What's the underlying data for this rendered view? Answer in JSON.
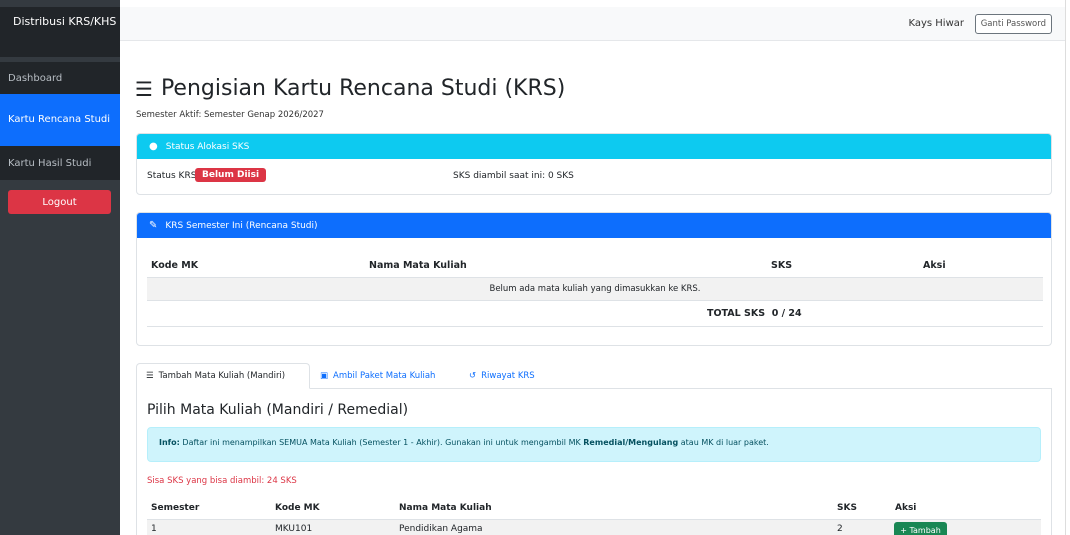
{
  "sidebar": {
    "brand": "Distribusi KRS/KHS",
    "items": [
      {
        "label": "Dashboard"
      },
      {
        "label": "Kartu Rencana Studi"
      },
      {
        "label": "Kartu Hasil Studi"
      }
    ],
    "logout_label": "Logout"
  },
  "topbar": {
    "user_name": "Kays Hiwar",
    "change_password_label": "Ganti Password"
  },
  "page": {
    "title": "Pengisian Kartu Rencana Studi (KRS)",
    "subtitle": "Semester Aktif: Semester Genap 2026/2027"
  },
  "status_card": {
    "header": "Status Alokasi SKS",
    "status_label": "Status KRS:",
    "status_badge": "Belum Diisi",
    "sks_taken": "SKS diambil saat ini: 0 SKS"
  },
  "krs_card": {
    "header": "KRS Semester Ini (Rencana Studi)",
    "columns": [
      "Kode MK",
      "Nama Mata Kuliah",
      "SKS",
      "Aksi"
    ],
    "empty_message": "Belum ada mata kuliah yang dimasukkan ke KRS.",
    "total_label": "TOTAL SKS",
    "total_value": "0 / 24"
  },
  "tabs": [
    {
      "label": "Tambah Mata Kuliah (Mandiri)"
    },
    {
      "label": "Ambil Paket Mata Kuliah"
    },
    {
      "label": "Riwayat KRS"
    }
  ],
  "panel": {
    "title": "Pilih Mata Kuliah (Mandiri / Remedial)",
    "info_strong": "Info:",
    "info_text1": " Daftar ini menampilkan SEMUA Mata Kuliah (Semester 1 - Akhir). Gunakan ini untuk mengambil MK ",
    "info_strong2": "Remedial/Mengulang",
    "info_text2": " atau MK di luar paket.",
    "remaining": "Sisa SKS yang bisa diambil: 24 SKS",
    "columns": [
      "Semester",
      "Kode MK",
      "Nama Mata Kuliah",
      "SKS",
      "Aksi"
    ],
    "rows": [
      {
        "semester": "1",
        "kode": "MKU101",
        "nama": "Pendidikan Agama",
        "sks": "2",
        "action": "+ Tambah"
      }
    ]
  }
}
